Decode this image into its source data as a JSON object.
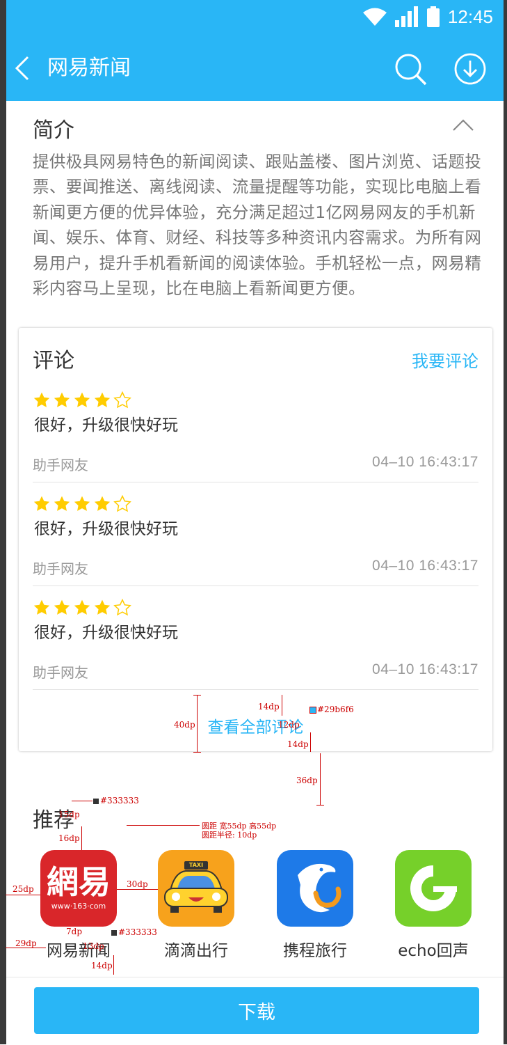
{
  "status_bar": {
    "time": "12:45"
  },
  "header": {
    "title": "网易新闻",
    "back_icon": "back-arrow-icon",
    "search_icon": "search-icon",
    "download_icon": "download-circle-icon"
  },
  "intro": {
    "title": "简介",
    "text": "提供极具网易特色的新闻阅读、跟贴盖楼、图片浏览、话题投票、要闻推送、离线阅读、流量提醒等功能，实现比电脑上看新闻更方便的优异体验，充分满足超过1亿网易网友的手机新闻、娱乐、体育、财经、科技等多种资讯内容需求。为所有网易用户，提升手机看新闻的阅读体验。手机轻松一点，网易精彩内容马上呈现，比在电脑上看新闻更方便。"
  },
  "reviews": {
    "title": "评论",
    "write_link": "我要评论",
    "items": [
      {
        "rating": 4,
        "max_rating": 5,
        "text": "很好，升级很快好玩",
        "user": "助手网友",
        "time": "04–10   16:43:17"
      },
      {
        "rating": 4,
        "max_rating": 5,
        "text": "很好，升级很快好玩",
        "user": "助手网友",
        "time": "04–10   16:43:17"
      },
      {
        "rating": 4,
        "max_rating": 5,
        "text": "很好，升级很快好玩",
        "user": "助手网友",
        "time": "04–10   16:43:17"
      }
    ],
    "view_all": "查看全部评论"
  },
  "recommend": {
    "title": "推荐",
    "apps": [
      {
        "name": "网易新闻",
        "icon_text": "網易",
        "icon_sub": "www·163·com",
        "color": "#d9262a"
      },
      {
        "name": "滴滴出行",
        "icon_text": "TAXI",
        "color": "#f7a21c"
      },
      {
        "name": "携程旅行",
        "color": "#1e7ae8"
      },
      {
        "name": "echo回声",
        "color": "#76d02a"
      }
    ]
  },
  "download_button": "下载",
  "annotations": {
    "a1": "14dp",
    "a2": "#29b6f6",
    "a3": "40dp",
    "a4": "12dp",
    "a5": "14dp",
    "a6": "36dp",
    "a7": "#333333",
    "a8": "15dp",
    "a9": "16dp",
    "a10": "圆距 宽55dp 高55dp",
    "a11": "圆距半径: 10dp",
    "a12": "25dp",
    "a13": "30dp",
    "a14": "7dp",
    "a15": "#333333",
    "a16": "13dp",
    "a17": "29dp",
    "a18": "14dp"
  },
  "colors": {
    "primary": "#29b6f6",
    "text": "#333333",
    "sub_text": "#777777",
    "meta": "#999999",
    "star": "#ffcc00",
    "annotation": "#cc0000"
  }
}
